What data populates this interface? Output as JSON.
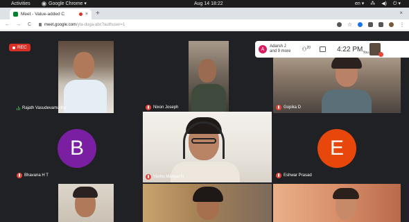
{
  "system_bar": {
    "activities": "Activities",
    "app_name": "Google Chrome ▾",
    "clock": "Aug 14 18:22",
    "tray_items": [
      "en ▾",
      "⁂",
      "◀)",
      "⏻ ▾"
    ]
  },
  "browser": {
    "tab_title": "Meet - Value-added C",
    "new_tab": "+",
    "close_window": "×",
    "nav": {
      "back": "←",
      "forward": "→",
      "reload": "C"
    },
    "url_host": "meet.google.com",
    "url_path": "/yta-duga-abc?authuser=1"
  },
  "meet": {
    "rec_label": "REC",
    "top_info": {
      "host_initial": "A",
      "host_name": "Adarsh J",
      "more": "and 9 more",
      "people_count": "20",
      "time": "4:22 PM",
      "self_label": "You"
    },
    "participants": [
      {
        "name": "Rajath Vasudevamurthy",
        "speaking": true
      },
      {
        "name": "Nixon Joseph",
        "muted": true
      },
      {
        "name": "Gopika D",
        "muted": true
      },
      {
        "name": "Bhavana H T",
        "muted": true,
        "initial": "B",
        "color": "#7b1fa2"
      },
      {
        "name": "Yashu Mangal N",
        "muted": true
      },
      {
        "name": "Eshwar Prasad",
        "muted": true,
        "initial": "E",
        "color": "#e8470b"
      }
    ]
  }
}
